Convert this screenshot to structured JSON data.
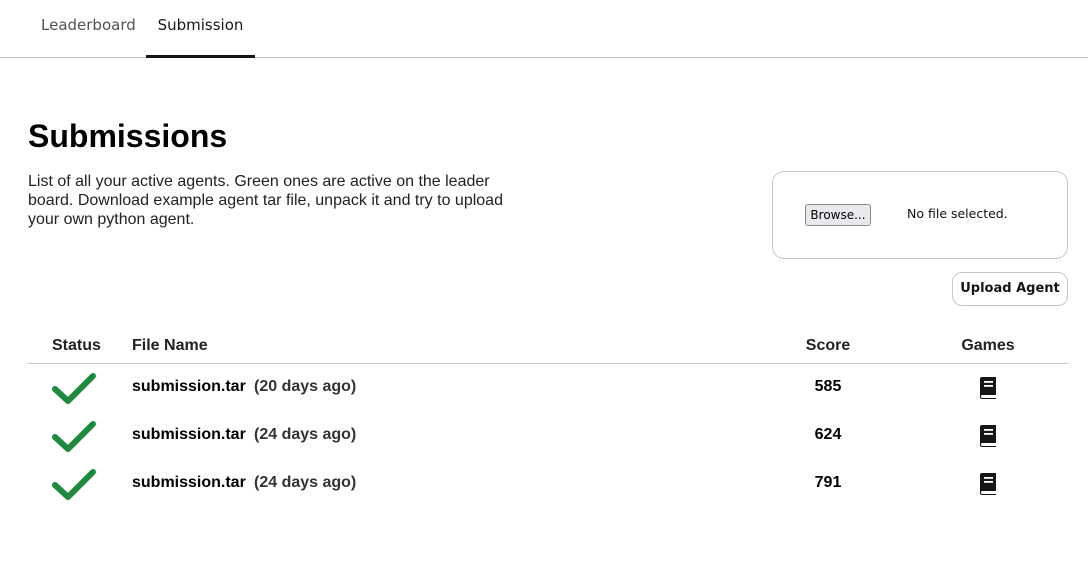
{
  "tabs": [
    {
      "label": "Leaderboard",
      "active": false
    },
    {
      "label": "Submission",
      "active": true
    }
  ],
  "page": {
    "title": "Submissions",
    "description": "List of all your active agents. Green ones are active on the leader board. Download example agent tar file, unpack it and try to upload your own python agent."
  },
  "file_input": {
    "browse_label": "Browse...",
    "status_text": "No file selected."
  },
  "upload_button_label": "Upload Agent",
  "table": {
    "headers": {
      "status": "Status",
      "file_name": "File Name",
      "score": "Score",
      "games": "Games"
    },
    "rows": [
      {
        "status": "check-icon",
        "file_name": "submission.tar",
        "age": "(20 days ago)",
        "score": "585",
        "games": "book-icon"
      },
      {
        "status": "check-icon",
        "file_name": "submission.tar",
        "age": "(24 days ago)",
        "score": "624",
        "games": "book-icon"
      },
      {
        "status": "check-icon",
        "file_name": "submission.tar",
        "age": "(24 days ago)",
        "score": "791",
        "games": "book-icon"
      }
    ]
  },
  "colors": {
    "active_green": "#1e8a3e",
    "tab_underline": "#161616",
    "border": "#c6c6c6"
  }
}
